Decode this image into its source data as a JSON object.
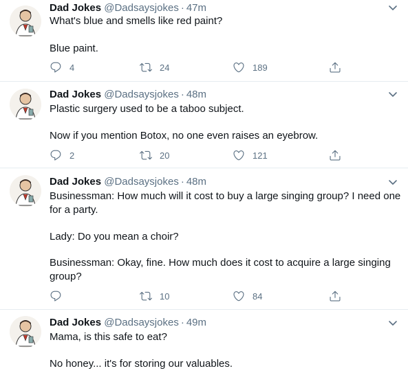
{
  "tweets": [
    {
      "name": "Dad Jokes",
      "handle": "@Dadsaysjokes",
      "sep": "·",
      "time": "47m",
      "lines": [
        "What's blue and smells like red paint?",
        "Blue paint."
      ],
      "replies": "4",
      "retweets": "24",
      "likes": "189"
    },
    {
      "name": "Dad Jokes",
      "handle": "@Dadsaysjokes",
      "sep": "·",
      "time": "48m",
      "lines": [
        "Plastic surgery used to be a taboo subject.",
        "Now if you mention Botox, no one even raises an eyebrow."
      ],
      "replies": "2",
      "retweets": "20",
      "likes": "121"
    },
    {
      "name": "Dad Jokes",
      "handle": "@Dadsaysjokes",
      "sep": "·",
      "time": "48m",
      "lines": [
        "Businessman: How much will it cost to buy a large singing group? I need one",
        "for a party.",
        "Lady: Do you mean a choir?",
        "Businessman: Okay, fine. How much does it cost to acquire a large singing",
        "group?"
      ],
      "replies": "",
      "retweets": "10",
      "likes": "84"
    },
    {
      "name": "Dad Jokes",
      "handle": "@Dadsaysjokes",
      "sep": "·",
      "time": "49m",
      "lines": [
        "Mama, is this safe to eat?",
        "No honey... it's for storing our valuables."
      ]
    }
  ],
  "icons": {
    "reply": "reply-icon",
    "retweet": "retweet-icon",
    "like": "heart-icon",
    "share": "share-icon",
    "more": "chevron-down-icon"
  },
  "colors": {
    "muted": "#5b7083",
    "text": "#0f1419",
    "divider": "#e6ecf0"
  }
}
